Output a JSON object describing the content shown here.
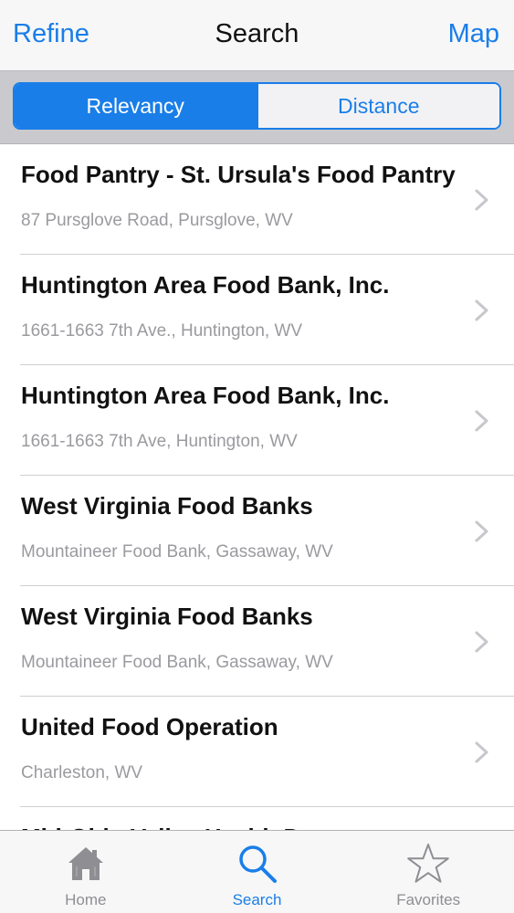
{
  "navbar": {
    "left_label": "Refine",
    "title": "Search",
    "right_label": "Map"
  },
  "segments": {
    "items": [
      {
        "label": "Relevancy",
        "selected": true
      },
      {
        "label": "Distance",
        "selected": false
      }
    ]
  },
  "results": [
    {
      "title": "Food Pantry - St. Ursula's Food Pantry",
      "address": "87  Pursglove Road, Pursglove, WV"
    },
    {
      "title": "Huntington Area Food Bank, Inc.",
      "address": "1661-1663 7th Ave., Huntington, WV"
    },
    {
      "title": "Huntington Area Food Bank, Inc.",
      "address": "1661-1663 7th Ave, Huntington, WV"
    },
    {
      "title": "West Virginia Food Banks",
      "address": "Mountaineer Food Bank, Gassaway, WV"
    },
    {
      "title": "West Virginia Food Banks",
      "address": "Mountaineer Food Bank, Gassaway, WV"
    },
    {
      "title": "United Food Operation",
      "address": "Charleston, WV"
    },
    {
      "title": "Mid-Ohio Valley Health Department",
      "address": ""
    }
  ],
  "tabbar": {
    "tabs": [
      {
        "label": "Home",
        "icon": "home-icon",
        "active": false
      },
      {
        "label": "Search",
        "icon": "search-icon",
        "active": true
      },
      {
        "label": "Favorites",
        "icon": "star-icon",
        "active": false
      }
    ]
  },
  "colors": {
    "accent": "#1a7ee8",
    "inactive_tab": "#8e8e93",
    "subtitle": "#9a9a9f"
  }
}
